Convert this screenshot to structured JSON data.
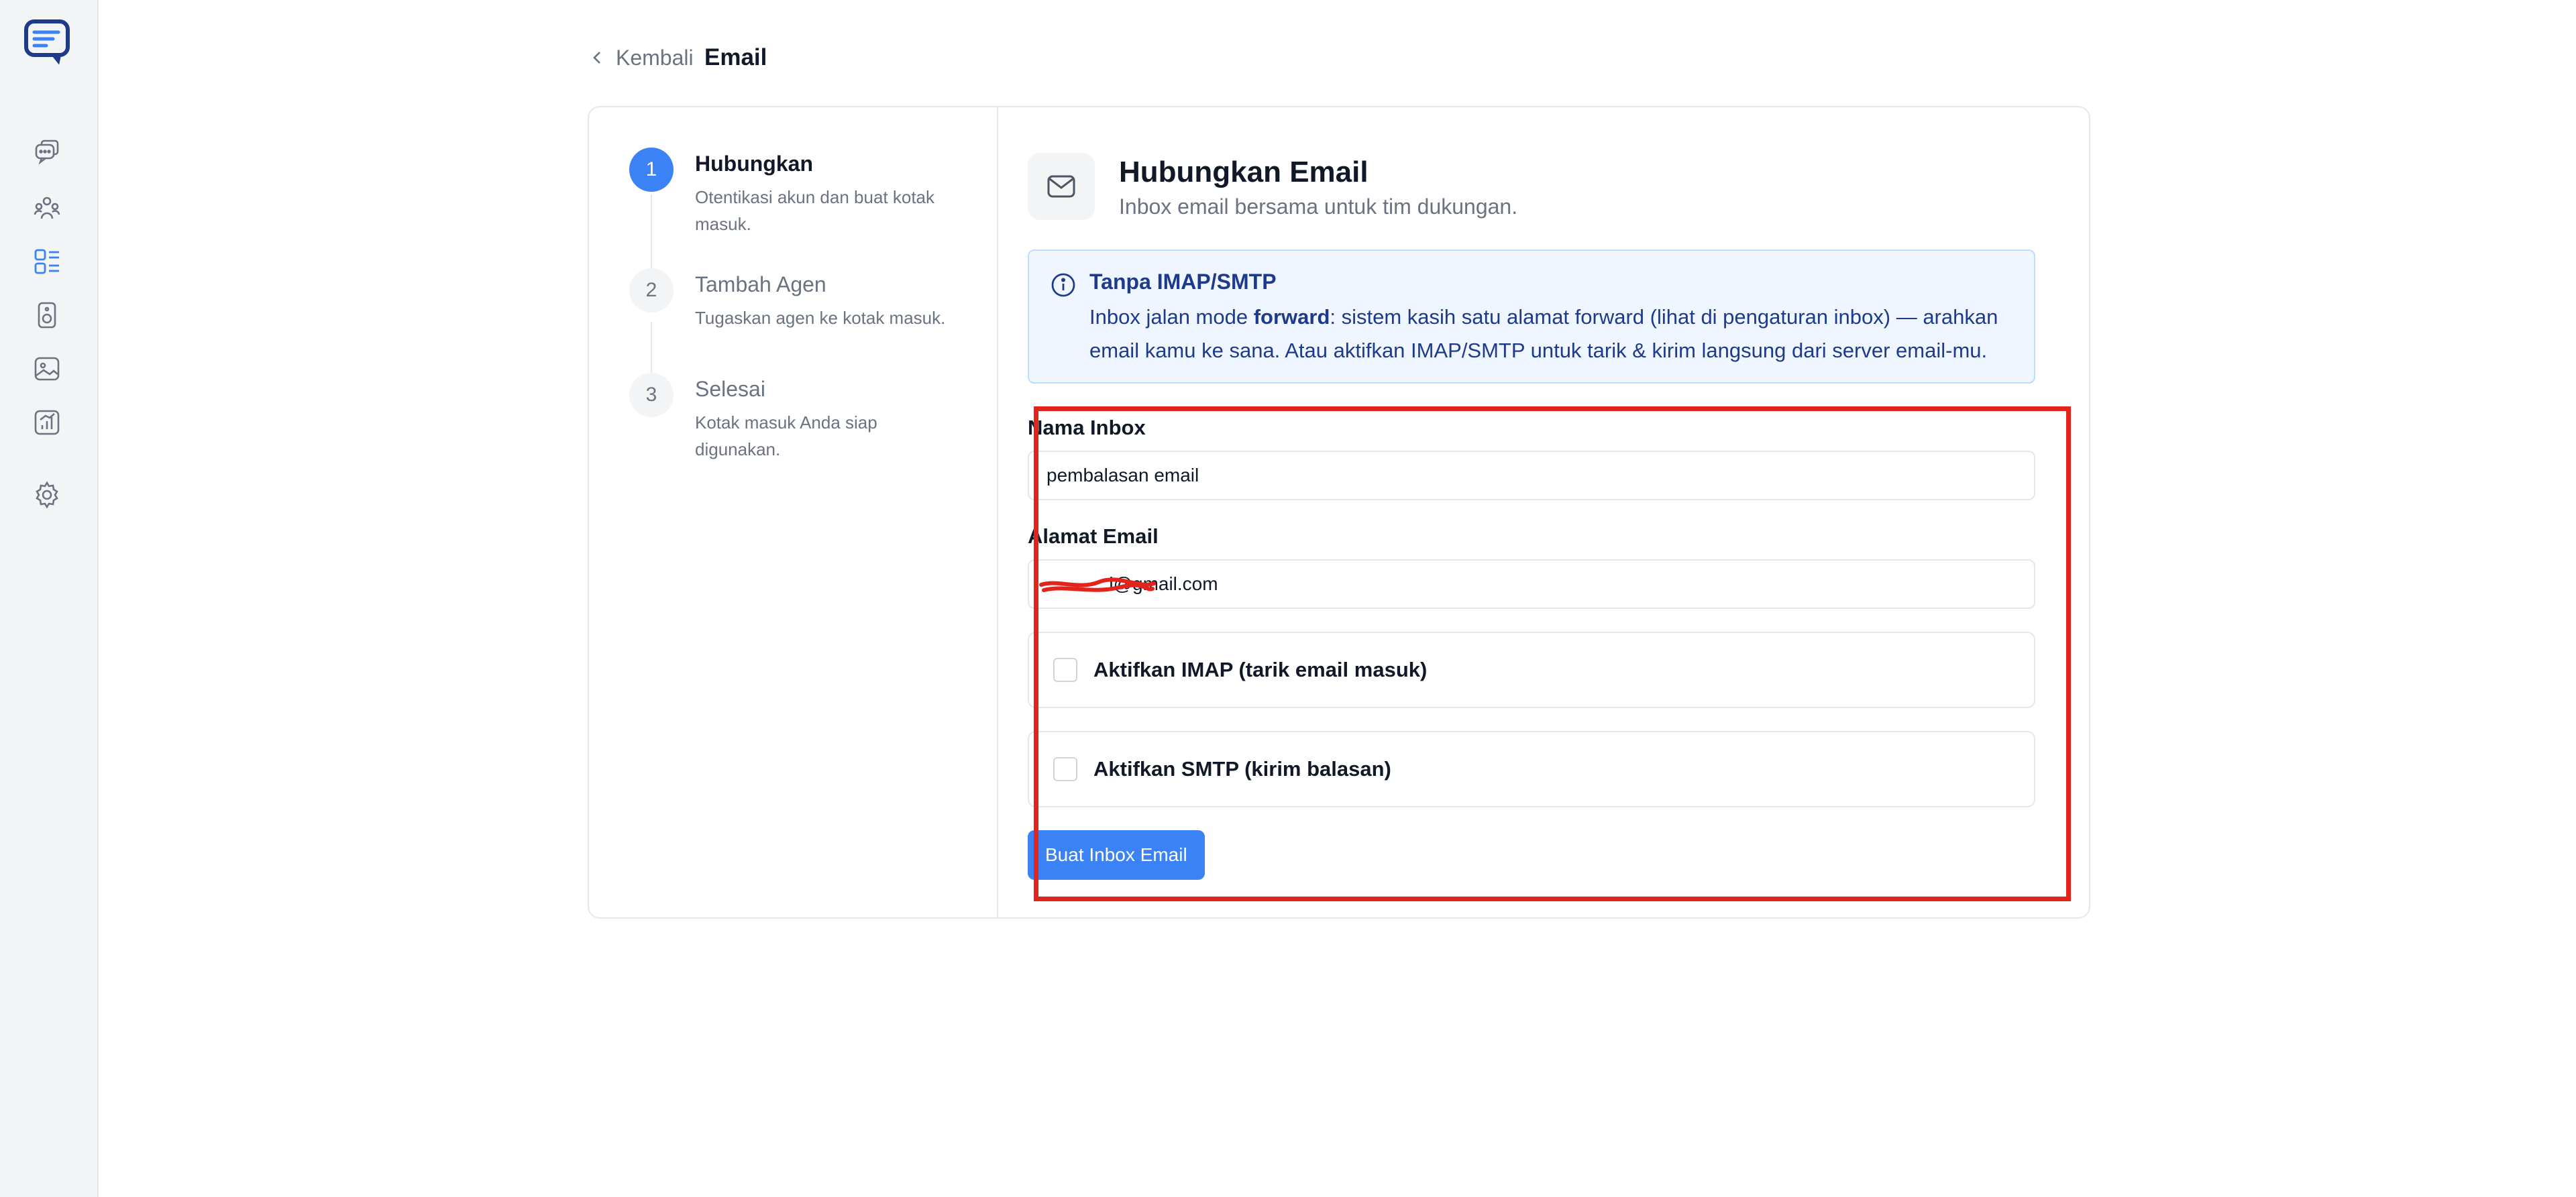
{
  "nav": {
    "back_label": "Kembali",
    "page_title": "Email",
    "rail_icons": [
      "chat-bubbles-icon",
      "contacts-icon",
      "dashboard-icon",
      "speaker-icon",
      "image-icon",
      "reports-icon",
      "gear-icon"
    ],
    "active_icon": "dashboard-icon"
  },
  "steps": [
    {
      "number": "1",
      "title": "Hubungkan",
      "description": "Otentikasi akun dan buat kotak masuk.",
      "active": true
    },
    {
      "number": "2",
      "title": "Tambah Agen",
      "description": "Tugaskan agen ke kotak masuk.",
      "active": false
    },
    {
      "number": "3",
      "title": "Selesai",
      "description": "Kotak masuk Anda siap digunakan.",
      "active": false
    }
  ],
  "header": {
    "title": "Hubungkan Email",
    "subtitle": "Inbox email bersama untuk tim dukungan."
  },
  "info": {
    "title": "Tanpa IMAP/SMTP",
    "body_prefix": "Inbox jalan mode ",
    "body_bold": "forward",
    "body_suffix": ": sistem kasih satu alamat forward (lihat di pengaturan inbox) — arahkan email kamu ke sana. Atau aktifkan IMAP/SMTP untuk tarik & kirim langsung dari server email-mu."
  },
  "form": {
    "inbox_name_label": "Nama Inbox",
    "inbox_name_value": "pembalasan email",
    "email_label": "Alamat Email",
    "email_value": "            l@gmail.com",
    "imap_label": "Aktifkan IMAP (tarik email masuk)",
    "imap_checked": false,
    "smtp_label": "Aktifkan SMTP (kirim balasan)",
    "smtp_checked": false,
    "submit_label": "Buat Inbox Email"
  },
  "colors": {
    "accent": "#3b82f6",
    "highlight": "#e3241b",
    "info_bg": "#eff6ff",
    "info_text": "#1e3a8a"
  }
}
